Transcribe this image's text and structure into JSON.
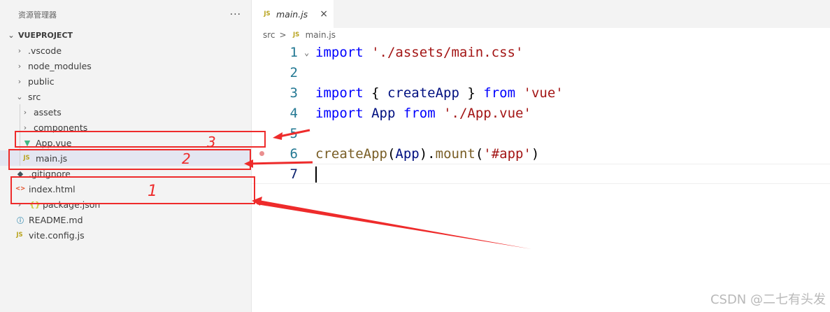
{
  "explorer": {
    "title": "资源管理器",
    "more_icon": "more-icon",
    "project_name": "VUEPROJECT",
    "items": [
      {
        "label": ".vscode",
        "type": "folder"
      },
      {
        "label": "node_modules",
        "type": "folder"
      },
      {
        "label": "public",
        "type": "folder"
      },
      {
        "label": "src",
        "type": "folder",
        "expanded": true
      },
      {
        "label": "assets",
        "type": "folder"
      },
      {
        "label": "components",
        "type": "folder"
      },
      {
        "label": "App.vue",
        "type": "vue"
      },
      {
        "label": "main.js",
        "type": "js",
        "selected": true
      },
      {
        "label": ".gitignore",
        "type": "git"
      },
      {
        "label": "index.html",
        "type": "html"
      },
      {
        "label": "package.json",
        "type": "json"
      },
      {
        "label": "README.md",
        "type": "md"
      },
      {
        "label": "vite.config.js",
        "type": "js"
      }
    ]
  },
  "editor": {
    "tab": {
      "label": "main.js",
      "icon": "JS",
      "close": "×"
    },
    "breadcrumb": {
      "folder": "src",
      "sep": ">",
      "file": "main.js"
    },
    "line_numbers": [
      "1",
      "2",
      "3",
      "4",
      "5",
      "6",
      "7"
    ],
    "fold_marker": "⌄",
    "lines": {
      "l1": {
        "kw": "import",
        "str": "'./assets/main.css'"
      },
      "l3": {
        "kw1": "import",
        "p1": "{ ",
        "ident": "createApp",
        "p2": " }",
        "kw2": "from",
        "str": "'vue'"
      },
      "l4": {
        "kw1": "import",
        "ident": "App",
        "kw2": "from",
        "str": "'./App.vue'"
      },
      "l6": {
        "fn": "createApp",
        "p1": "(",
        "ident": "App",
        "p2": ").",
        "fn2": "mount",
        "p3": "(",
        "str": "'#app'",
        "p4": ")"
      }
    }
  },
  "annotations": {
    "color": "#ee2b2b",
    "label_1": "1",
    "label_2": "2",
    "label_3": "3"
  },
  "watermark": "CSDN @二七有头发",
  "colors": {
    "keyword": "#0000ff",
    "string": "#a31515",
    "function": "#795e26",
    "line_number": "#237893",
    "selected_row": "#e4e6f1"
  }
}
